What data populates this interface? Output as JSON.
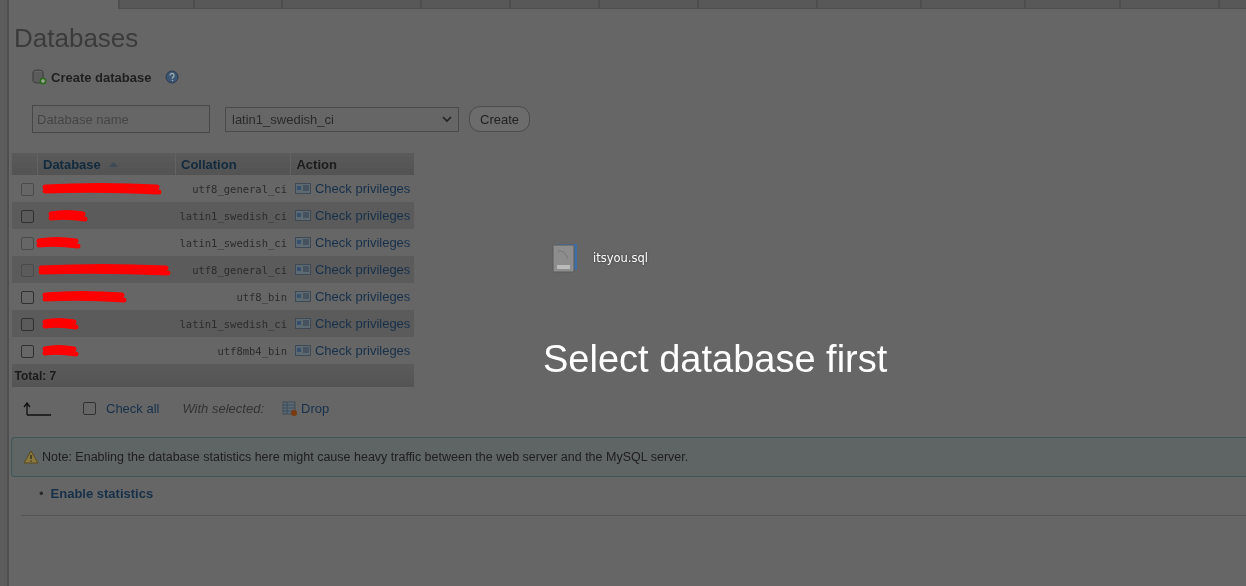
{
  "page_title": "Databases",
  "create_database": {
    "label": "Create database",
    "name_field": {
      "placeholder": "Database name"
    },
    "collation_select": {
      "value": "latin1_swedish_ci"
    },
    "button": "Create"
  },
  "table": {
    "columns": [
      {
        "label": "Database",
        "kind": "link",
        "sorted": true
      },
      {
        "label": "Collation",
        "kind": "link",
        "sorted": false
      },
      {
        "label": "Action",
        "kind": "plain",
        "sorted": false
      }
    ],
    "rows": [
      {
        "redacted": true,
        "collation": "utf8_general_ci",
        "action": "Check privileges",
        "checked": false,
        "disabled": true
      },
      {
        "redacted": true,
        "collation": "latin1_swedish_ci",
        "action": "Check privileges",
        "checked": false,
        "disabled": false
      },
      {
        "redacted": true,
        "collation": "latin1_swedish_ci",
        "action": "Check privileges",
        "checked": false,
        "disabled": true
      },
      {
        "redacted": true,
        "collation": "utf8_general_ci",
        "action": "Check privileges",
        "checked": false,
        "disabled": true
      },
      {
        "redacted": true,
        "collation": "utf8_bin",
        "action": "Check privileges",
        "checked": false,
        "disabled": false
      },
      {
        "redacted": true,
        "collation": "latin1_swedish_ci",
        "action": "Check privileges",
        "checked": false,
        "disabled": false
      },
      {
        "redacted": true,
        "collation": "utf8mb4_bin",
        "action": "Check privileges",
        "checked": false,
        "disabled": false
      }
    ],
    "total": "Total: 7"
  },
  "bulk_actions": {
    "check_all": {
      "label": "Check all",
      "checked": false
    },
    "with_selected": "With selected:",
    "drop": "Drop"
  },
  "note": "Note: Enabling the database statistics here might cause heavy traffic between the web server and the MySQL server.",
  "links": [
    {
      "marker": "•",
      "label": "Enable statistics"
    }
  ],
  "drop_overlay": {
    "file_name": "itsyou.sql",
    "message": "Select database first"
  }
}
